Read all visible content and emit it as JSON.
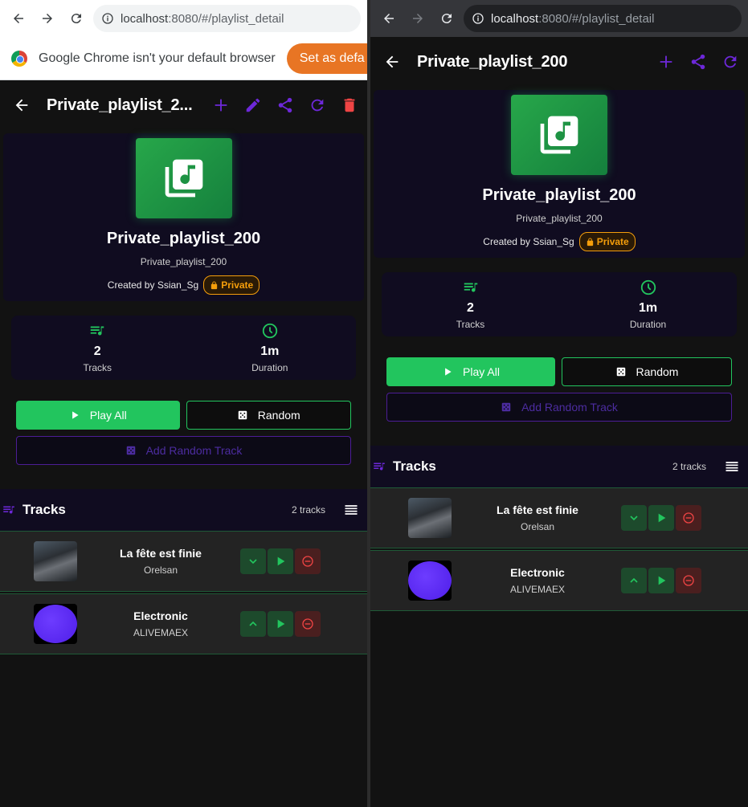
{
  "browser": {
    "url_host": "localhost",
    "url_path": ":8080/#/playlist_detail",
    "infobar_message": "Google Chrome isn't your default browser",
    "infobar_button": "Set as defa"
  },
  "app": {
    "title_left": "Private_playlist_2...",
    "title_right": "Private_playlist_200",
    "playlist_name": "Private_playlist_200",
    "playlist_description": "Private_playlist_200",
    "created_by": "Created by Ssian_Sg",
    "privacy_badge": "Private",
    "stats": {
      "tracks_value": "2",
      "tracks_label": "Tracks",
      "duration_value": "1m",
      "duration_label": "Duration"
    },
    "buttons": {
      "play_all": "Play All",
      "random": "Random",
      "add_random_track": "Add Random Track"
    },
    "tracks_header": "Tracks",
    "tracks_count": "2 tracks",
    "tracks": [
      {
        "title": "La fête est finie",
        "artist": "Orelsan"
      },
      {
        "title": "Electronic",
        "artist": "ALIVEMAEX"
      }
    ]
  },
  "colors": {
    "accent_purple": "#6d28d9",
    "accent_green": "#22c55e",
    "delete_red": "#ef4444",
    "private_orange": "#f59e0b"
  },
  "icons": [
    "back-arrow-icon",
    "reload-icon",
    "info-icon",
    "add-icon",
    "edit-icon",
    "share-icon",
    "refresh-icon",
    "delete-icon",
    "playlist-music-icon",
    "queue-music-icon",
    "clock-icon",
    "play-icon",
    "dice-icon",
    "list-icon",
    "chevron-down-icon",
    "chevron-up-icon",
    "remove-icon",
    "lock-icon"
  ]
}
